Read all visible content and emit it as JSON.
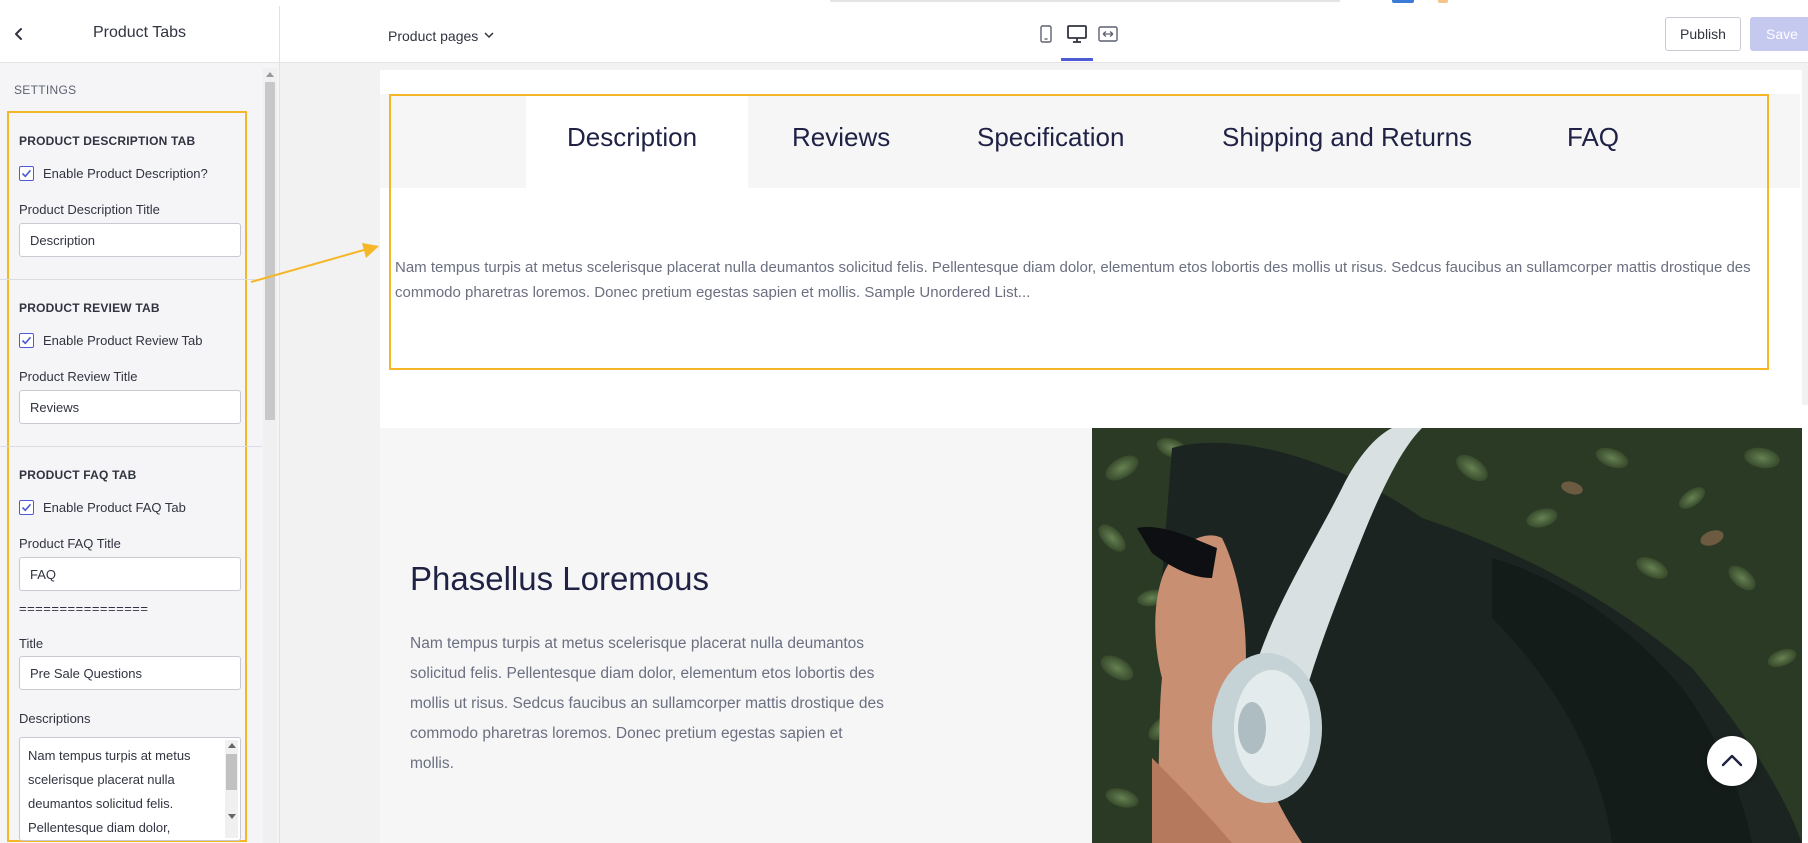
{
  "sidebar": {
    "title": "Product Tabs",
    "settings_label": "SETTINGS",
    "description_section": {
      "heading": "PRODUCT DESCRIPTION TAB",
      "enable_label": "Enable Product Description?",
      "enable_checked": true,
      "title_label": "Product Description Title",
      "title_value": "Description"
    },
    "review_section": {
      "heading": "PRODUCT REVIEW TAB",
      "enable_label": "Enable Product Review Tab",
      "enable_checked": true,
      "title_label": "Product Review Title",
      "title_value": "Reviews"
    },
    "faq_section": {
      "heading": "PRODUCT FAQ TAB",
      "enable_label": "Enable Product FAQ Tab",
      "enable_checked": true,
      "title_label": "Product FAQ Title",
      "title_value": "FAQ",
      "divider": "================",
      "question_title_label": "Title",
      "question_title_value": "Pre Sale Questions",
      "descriptions_label": "Descriptions",
      "descriptions_value": "Nam tempus turpis at metus scelerisque placerat nulla deumantos solicitud felis. Pellentesque diam dolor,"
    }
  },
  "topbar": {
    "page_select": "Product pages",
    "publish_label": "Publish",
    "save_label": "Save",
    "accent_color": "#4f5bd5"
  },
  "preview": {
    "tabs": [
      "Description",
      "Reviews",
      "Specification",
      "Shipping and Returns",
      "FAQ"
    ],
    "active_tab": "Description",
    "tab_content": "Nam tempus turpis at metus scelerisque placerat nulla deumantos solicitud felis. Pellentesque diam dolor, elementum etos lobortis des mollis ut risus. Sedcus faucibus an sullamcorper mattis drostique des commodo pharetras loremos. Donec pretium egestas sapien et mollis. Sample Unordered List...",
    "feature_title": "Phasellus Loremous",
    "feature_text": "Nam tempus turpis at metus scelerisque placerat nulla deumantos solicitud felis. Pellentesque diam dolor, elementum etos lobortis des mollis ut risus. Sedcus faucibus an sullamcorper mattis drostique des commodo pharetras loremos. Donec pretium egestas sapien et mollis.",
    "highlight_color": "#f5b728"
  }
}
